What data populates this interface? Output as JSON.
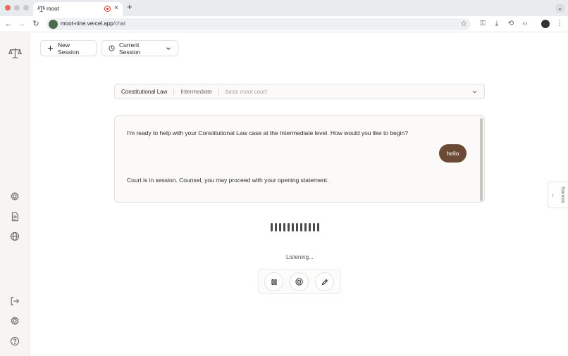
{
  "browser": {
    "tab_title": "moot",
    "new_tab_symbol": "+",
    "close_symbol": "×",
    "url_host": "moot-nine.vercel.app",
    "url_path": "/chat"
  },
  "header": {
    "new_session_label": "New Session",
    "current_session_label": "Current Session"
  },
  "topic": {
    "subject": "Constitutional Law",
    "level": "Intermediate",
    "description": "basic moot court"
  },
  "chat": {
    "messages": [
      {
        "role": "assistant",
        "text": "I'm ready to help with your Constitutional Law case at the Intermediate level. How would you like to begin?"
      },
      {
        "role": "user",
        "text": "hello"
      },
      {
        "role": "assistant",
        "text": "Court is in session. Counsel, you may proceed with your opening statement."
      }
    ]
  },
  "voice": {
    "status": "Listening...",
    "bars": 12
  },
  "sources": {
    "label": "Sources"
  },
  "icons": {
    "sidebar_top": [
      "scales-icon"
    ],
    "sidebar_mid": [
      "settings-icon",
      "document-icon",
      "globe-icon"
    ],
    "sidebar_bottom": [
      "logout-icon",
      "settings-icon",
      "help-icon"
    ],
    "controls": [
      "pause-icon",
      "stop-icon",
      "pencil-icon"
    ]
  },
  "colors": {
    "user_bubble": "#6b4a35",
    "sidebar_bg": "#f6f5f3",
    "card_bg": "#fbfaf9"
  }
}
